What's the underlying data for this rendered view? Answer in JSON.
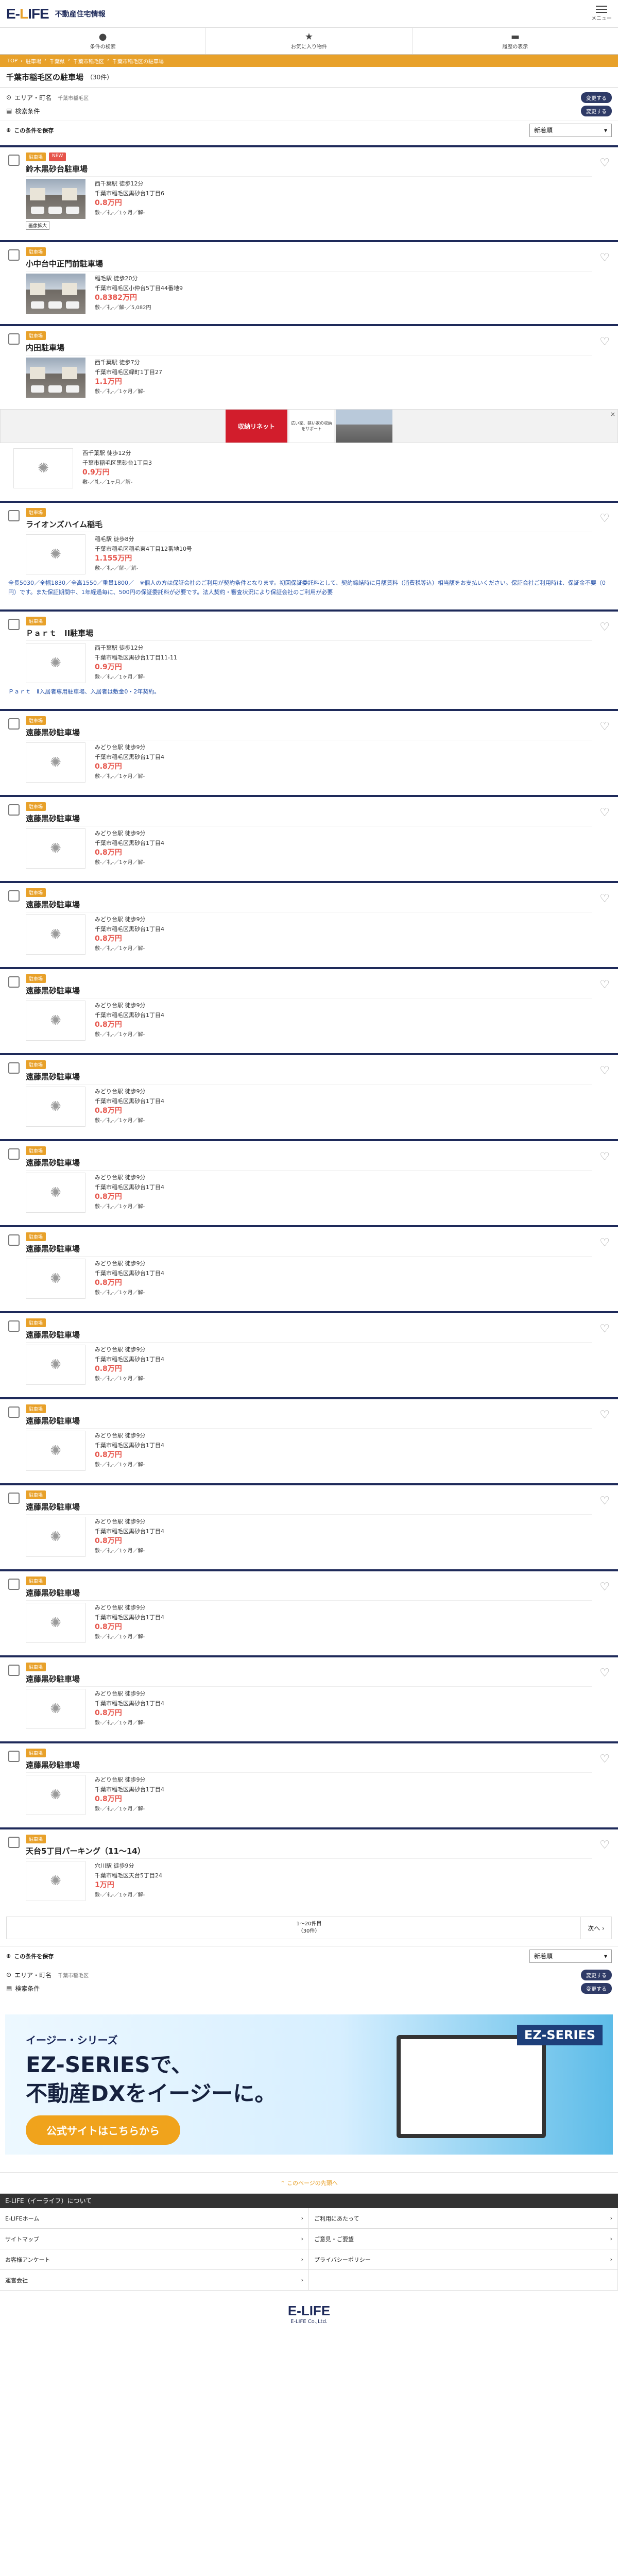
{
  "site": {
    "logo": "E-LIFE",
    "tagline": "不動産住宅情報",
    "menu": "メニュー"
  },
  "nav": [
    {
      "label": "条件の検索",
      "icon": "chat-icon"
    },
    {
      "label": "お気に入り物件",
      "icon": "star-icon"
    },
    {
      "label": "履歴の表示",
      "icon": "folder-icon"
    }
  ],
  "crumbs": [
    "TOP",
    "駐車場",
    "千葉県",
    "千葉市稲毛区",
    "千葉市稲毛区の駐車場"
  ],
  "page": {
    "title": "千葉市稲毛区の駐車場",
    "count": "（30件）"
  },
  "conditions": {
    "area_label": "エリア・町名",
    "area_value": "千葉市稲毛区",
    "keyword_label": "検索条件",
    "change": "変更する"
  },
  "save": {
    "label": "この条件を保存",
    "sort": "新着順"
  },
  "listings": [
    {
      "tags": [
        "駐車場",
        "NEW"
      ],
      "name": "鈴木黒砂台駐車場",
      "station": "西千葉駅 徒歩12分",
      "address": "千葉市稲毛区黒砂台1丁目6",
      "price": "0.8万円",
      "terms": "敷-／礼-／1ヶ月／解-",
      "img": "lot",
      "imgbtn": "画像拡大"
    },
    {
      "tags": [
        "駐車場"
      ],
      "name": "小中台中正門前駐車場",
      "station": "稲毛駅 徒歩20分",
      "address": "千葉市稲毛区小仲台5丁目44番地9",
      "price": "0.8382万円",
      "terms": "敷-／礼-／解-／5,082円",
      "img": "lot"
    },
    {
      "tags": [
        "駐車場"
      ],
      "name": "内田駐車場",
      "station": "西千葉駅 徒歩7分",
      "address": "千葉市稲毛区緑町1丁目27",
      "price": "1.1万円",
      "terms": "敷-／礼-／1ヶ月／解-",
      "img": "lot"
    }
  ],
  "ad": {
    "title": "収納リネット",
    "sub": "広い家、狭い家の収納をサポート",
    "close": "×"
  },
  "partial": {
    "station": "西千葉駅 徒歩12分",
    "address": "千葉市稲毛区黒砂台1丁目3",
    "price": "0.9万円",
    "terms": "敷-／礼-／1ヶ月／解-"
  },
  "listings2": [
    {
      "tags": [
        "駐車場"
      ],
      "name": "ライオンズハイム稲毛",
      "station": "稲毛駅 徒歩8分",
      "address": "千葉市稲毛区稲毛東4丁目12番地10号",
      "price": "1.155万円",
      "terms": "敷-／礼-／解-／解-",
      "note": "全長5030／全幅1830／全高1550／重量1800／　※個人の方は保証会社のご利用が契約条件となります。初回保証委託料として、契約締結時に月額賃料（消費税等込）相当額をお支払いください。保証会社ご利用時は、保証金不要（0円）です。また保証期間中、1年経過毎に、500円の保証委託料が必要です。法人契約・審査状況により保証会社のご利用が必要"
    },
    {
      "tags": [
        "駐車場"
      ],
      "name": "Ｐａｒｔ　II駐車場",
      "station": "西千葉駅 徒歩12分",
      "address": "千葉市稲毛区黒砂台1丁目11-11",
      "price": "0.9万円",
      "terms": "敷-／礼-／1ヶ月／解-",
      "note": "Ｐａｒｔ　Ⅱ入居者専用駐車場、入居者は敷金0・2年契約。"
    }
  ],
  "repeat": {
    "tags": [
      "駐車場"
    ],
    "name": "遠藤黒砂駐車場",
    "station": "みどり台駅 徒歩9分",
    "address": "千葉市稲毛区黒砂台1丁目4",
    "price": "0.8万円",
    "terms": "敷-／礼-／1ヶ月／解-"
  },
  "last": {
    "tags": [
      "駐車場"
    ],
    "name": "天台5丁目パーキング（11～14）",
    "station": "穴川駅 徒歩9分",
    "address": "千葉市稲毛区天台5丁目24",
    "price": "1万円",
    "terms": "敷-／礼-／1ヶ月／解-"
  },
  "pager": {
    "range": "1～20件目",
    "total": "（30件）",
    "next": "次へ ›"
  },
  "banner": {
    "sub": "イージー・シリーズ",
    "line1": "EZ-SERIESで、",
    "line2": "不動産DXをイージーに。",
    "cta": "公式サイトはこちらから",
    "logo": "EZ-SERIES"
  },
  "more": "このページの先頭へ",
  "about": "E-LIFE（イーライフ）について",
  "links": [
    "E-LIFEホーム",
    "ご利用にあたって",
    "サイトマップ",
    "ご意見・ご要望",
    "お客様アンケート",
    "プライバシーポリシー",
    "運営会社",
    ""
  ],
  "footer": {
    "logo": "E-LIFE",
    "company": "E-LIFE Co.,Ltd."
  }
}
